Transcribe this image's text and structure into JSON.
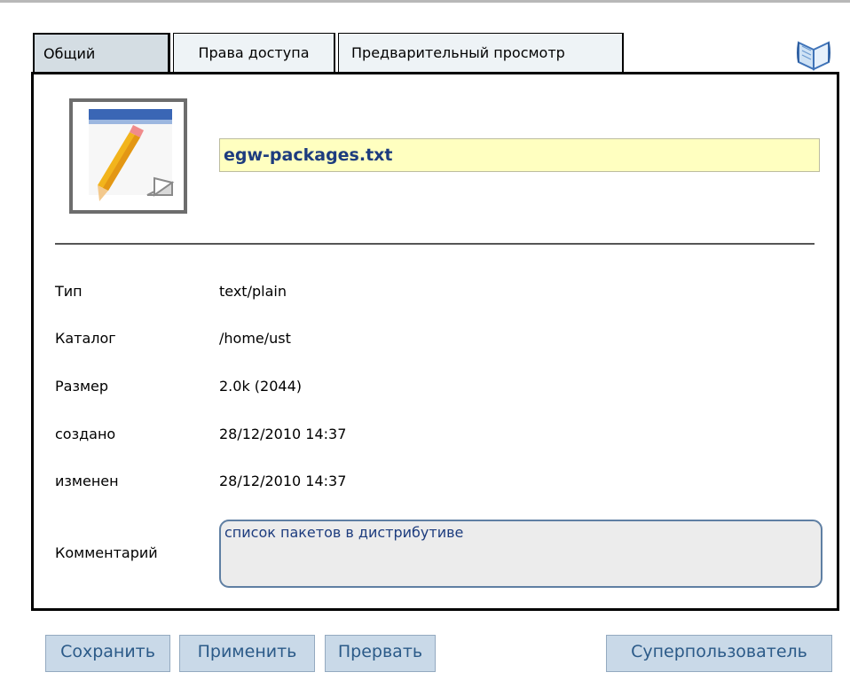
{
  "tabs": [
    {
      "label": "Общий",
      "active": true
    },
    {
      "label": "Права доступа",
      "active": false
    },
    {
      "label": "Предварительный просмотр",
      "active": false
    }
  ],
  "file": {
    "name": "egw-packages.txt",
    "icon": "text-file-pencil-icon"
  },
  "properties": [
    {
      "label": "Тип",
      "value": "text/plain"
    },
    {
      "label": "Каталог",
      "value": "/home/ust"
    },
    {
      "label": "Размер",
      "value": "2.0k (2044)"
    },
    {
      "label": "создано",
      "value": "28/12/2010 14:37"
    },
    {
      "label": "изменен",
      "value": "28/12/2010 14:37"
    }
  ],
  "comment": {
    "label": "Комментарий",
    "value": "список пакетов в дистрибутиве"
  },
  "buttons": {
    "save": "Сохранить",
    "apply": "Применить",
    "cancel": "Прервать",
    "superuser": "Суперпользователь"
  },
  "colors": {
    "tab_active_bg": "#d4dde3",
    "tab_bg": "#eef3f6",
    "filename_bg": "#ffffc0",
    "filename_text": "#1d3c7e",
    "button_bg": "#c9d9e8",
    "button_text": "#2b5a88",
    "comment_border": "#5f7fa3"
  }
}
